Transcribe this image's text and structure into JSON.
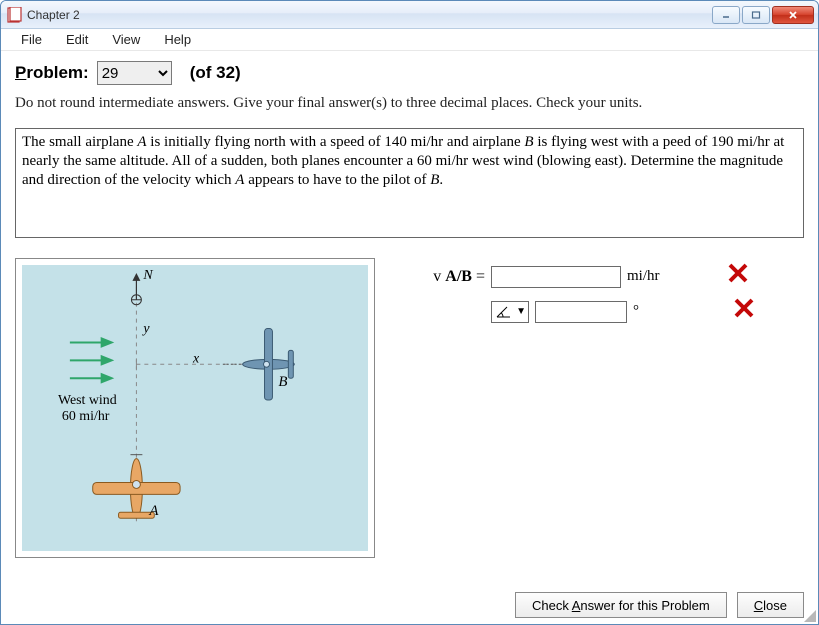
{
  "window": {
    "title": "Chapter 2"
  },
  "menu": {
    "file": "File",
    "edit": "Edit",
    "view": "View",
    "help": "Help"
  },
  "problem": {
    "label_pre": "P",
    "label_post": "roblem:",
    "number": "29",
    "of_total": "(of 32)"
  },
  "instructions": "Do not round intermediate answers.  Give your final answer(s) to three decimal places.  Check your units.",
  "problem_text": {
    "t1": "The small airplane ",
    "A": "A",
    "t2": " is initially flying north with a speed of 140 mi/hr and airplane ",
    "B": "B",
    "t3": " is flying west with a peed of 190 mi/hr at nearly the same altitude.  All of a sudden, both planes encounter a 60 mi/hr west wind (blowing east).  Determine the magnitude and direction of the velocity which ",
    "A2": "A",
    "t4": " appears to have to the pilot of ",
    "B2": "B",
    "t5": "."
  },
  "diagram": {
    "N": "N",
    "y": "y",
    "x": "x",
    "B": "B",
    "A": "A",
    "wind_label1": "West wind",
    "wind_label2": "60 mi/hr"
  },
  "answers": {
    "row1": {
      "label": "v A/B =",
      "value": "",
      "unit": "mi/hr",
      "status": "✖"
    },
    "row2": {
      "label": "",
      "angle_value": "",
      "unit": "°",
      "status": "✖"
    }
  },
  "buttons": {
    "check_pre": "Check ",
    "check_ul": "A",
    "check_post": "nswer for this Problem",
    "close_pre": "",
    "close_ul": "C",
    "close_post": "lose"
  }
}
